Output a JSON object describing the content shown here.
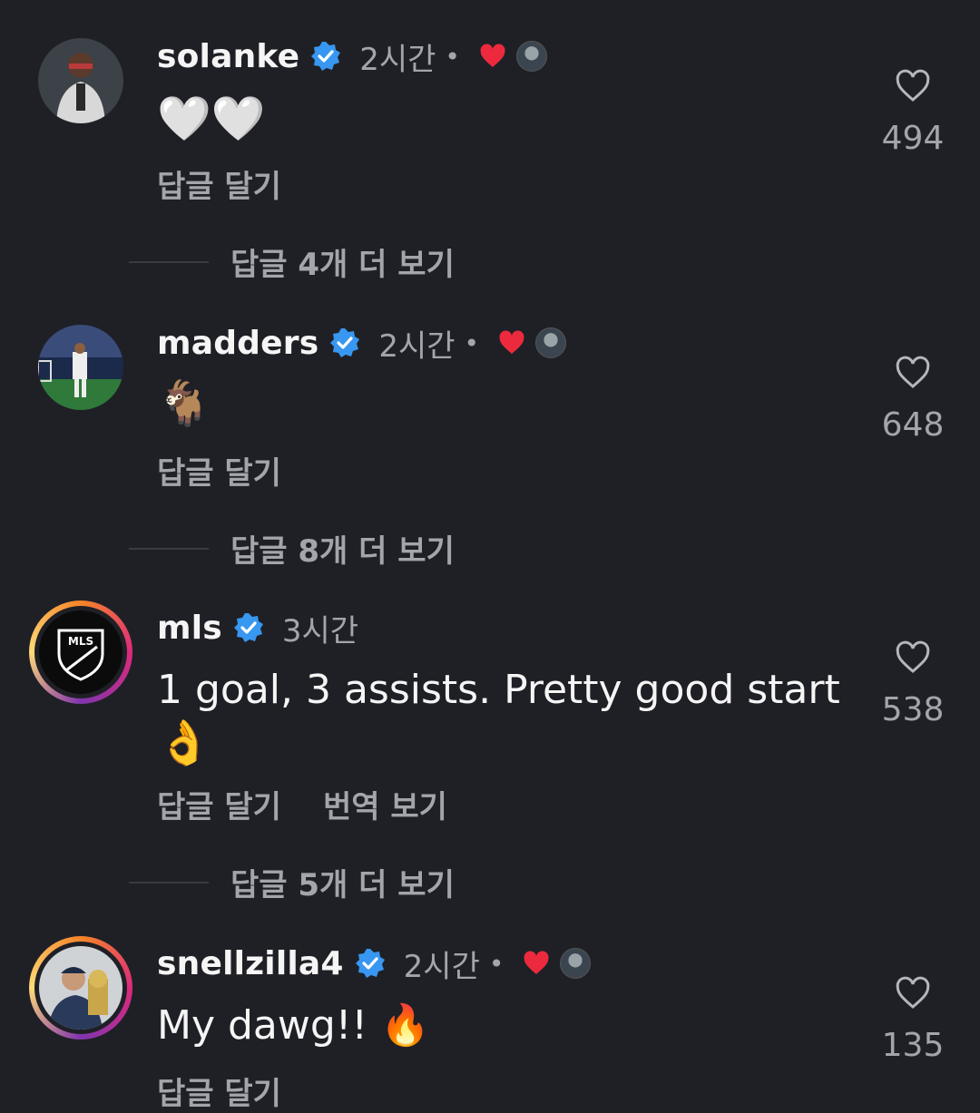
{
  "comments": [
    {
      "username": "solanke",
      "time": "2시간",
      "dot": "•",
      "text": "🤍🤍",
      "reply_label": "답글 달기",
      "like_count": "494",
      "more_replies": "답글 4개 더 보기"
    },
    {
      "username": "madders",
      "time": "2시간",
      "dot": "•",
      "text": "🐐",
      "reply_label": "답글 달기",
      "like_count": "648",
      "more_replies": "답글 8개 더 보기"
    },
    {
      "username": "mls",
      "time": "3시간",
      "text_line1": "1 goal, 3 assists. Pretty good start",
      "text_line2": "👌",
      "avatar_text": "MLS",
      "reply_label": "답글 달기",
      "translate_label": "번역 보기",
      "like_count": "538",
      "more_replies": "답글 5개 더 보기"
    },
    {
      "username": "snellzilla4",
      "time": "2시간",
      "dot": "•",
      "text": "My dawg!! 🔥",
      "reply_label": "답글 달기",
      "like_count": "135"
    }
  ],
  "colors": {
    "background": "#1f2026",
    "verified": "#3897f0",
    "heart": "#ed2a3d",
    "muted": "#a3a5ab"
  }
}
